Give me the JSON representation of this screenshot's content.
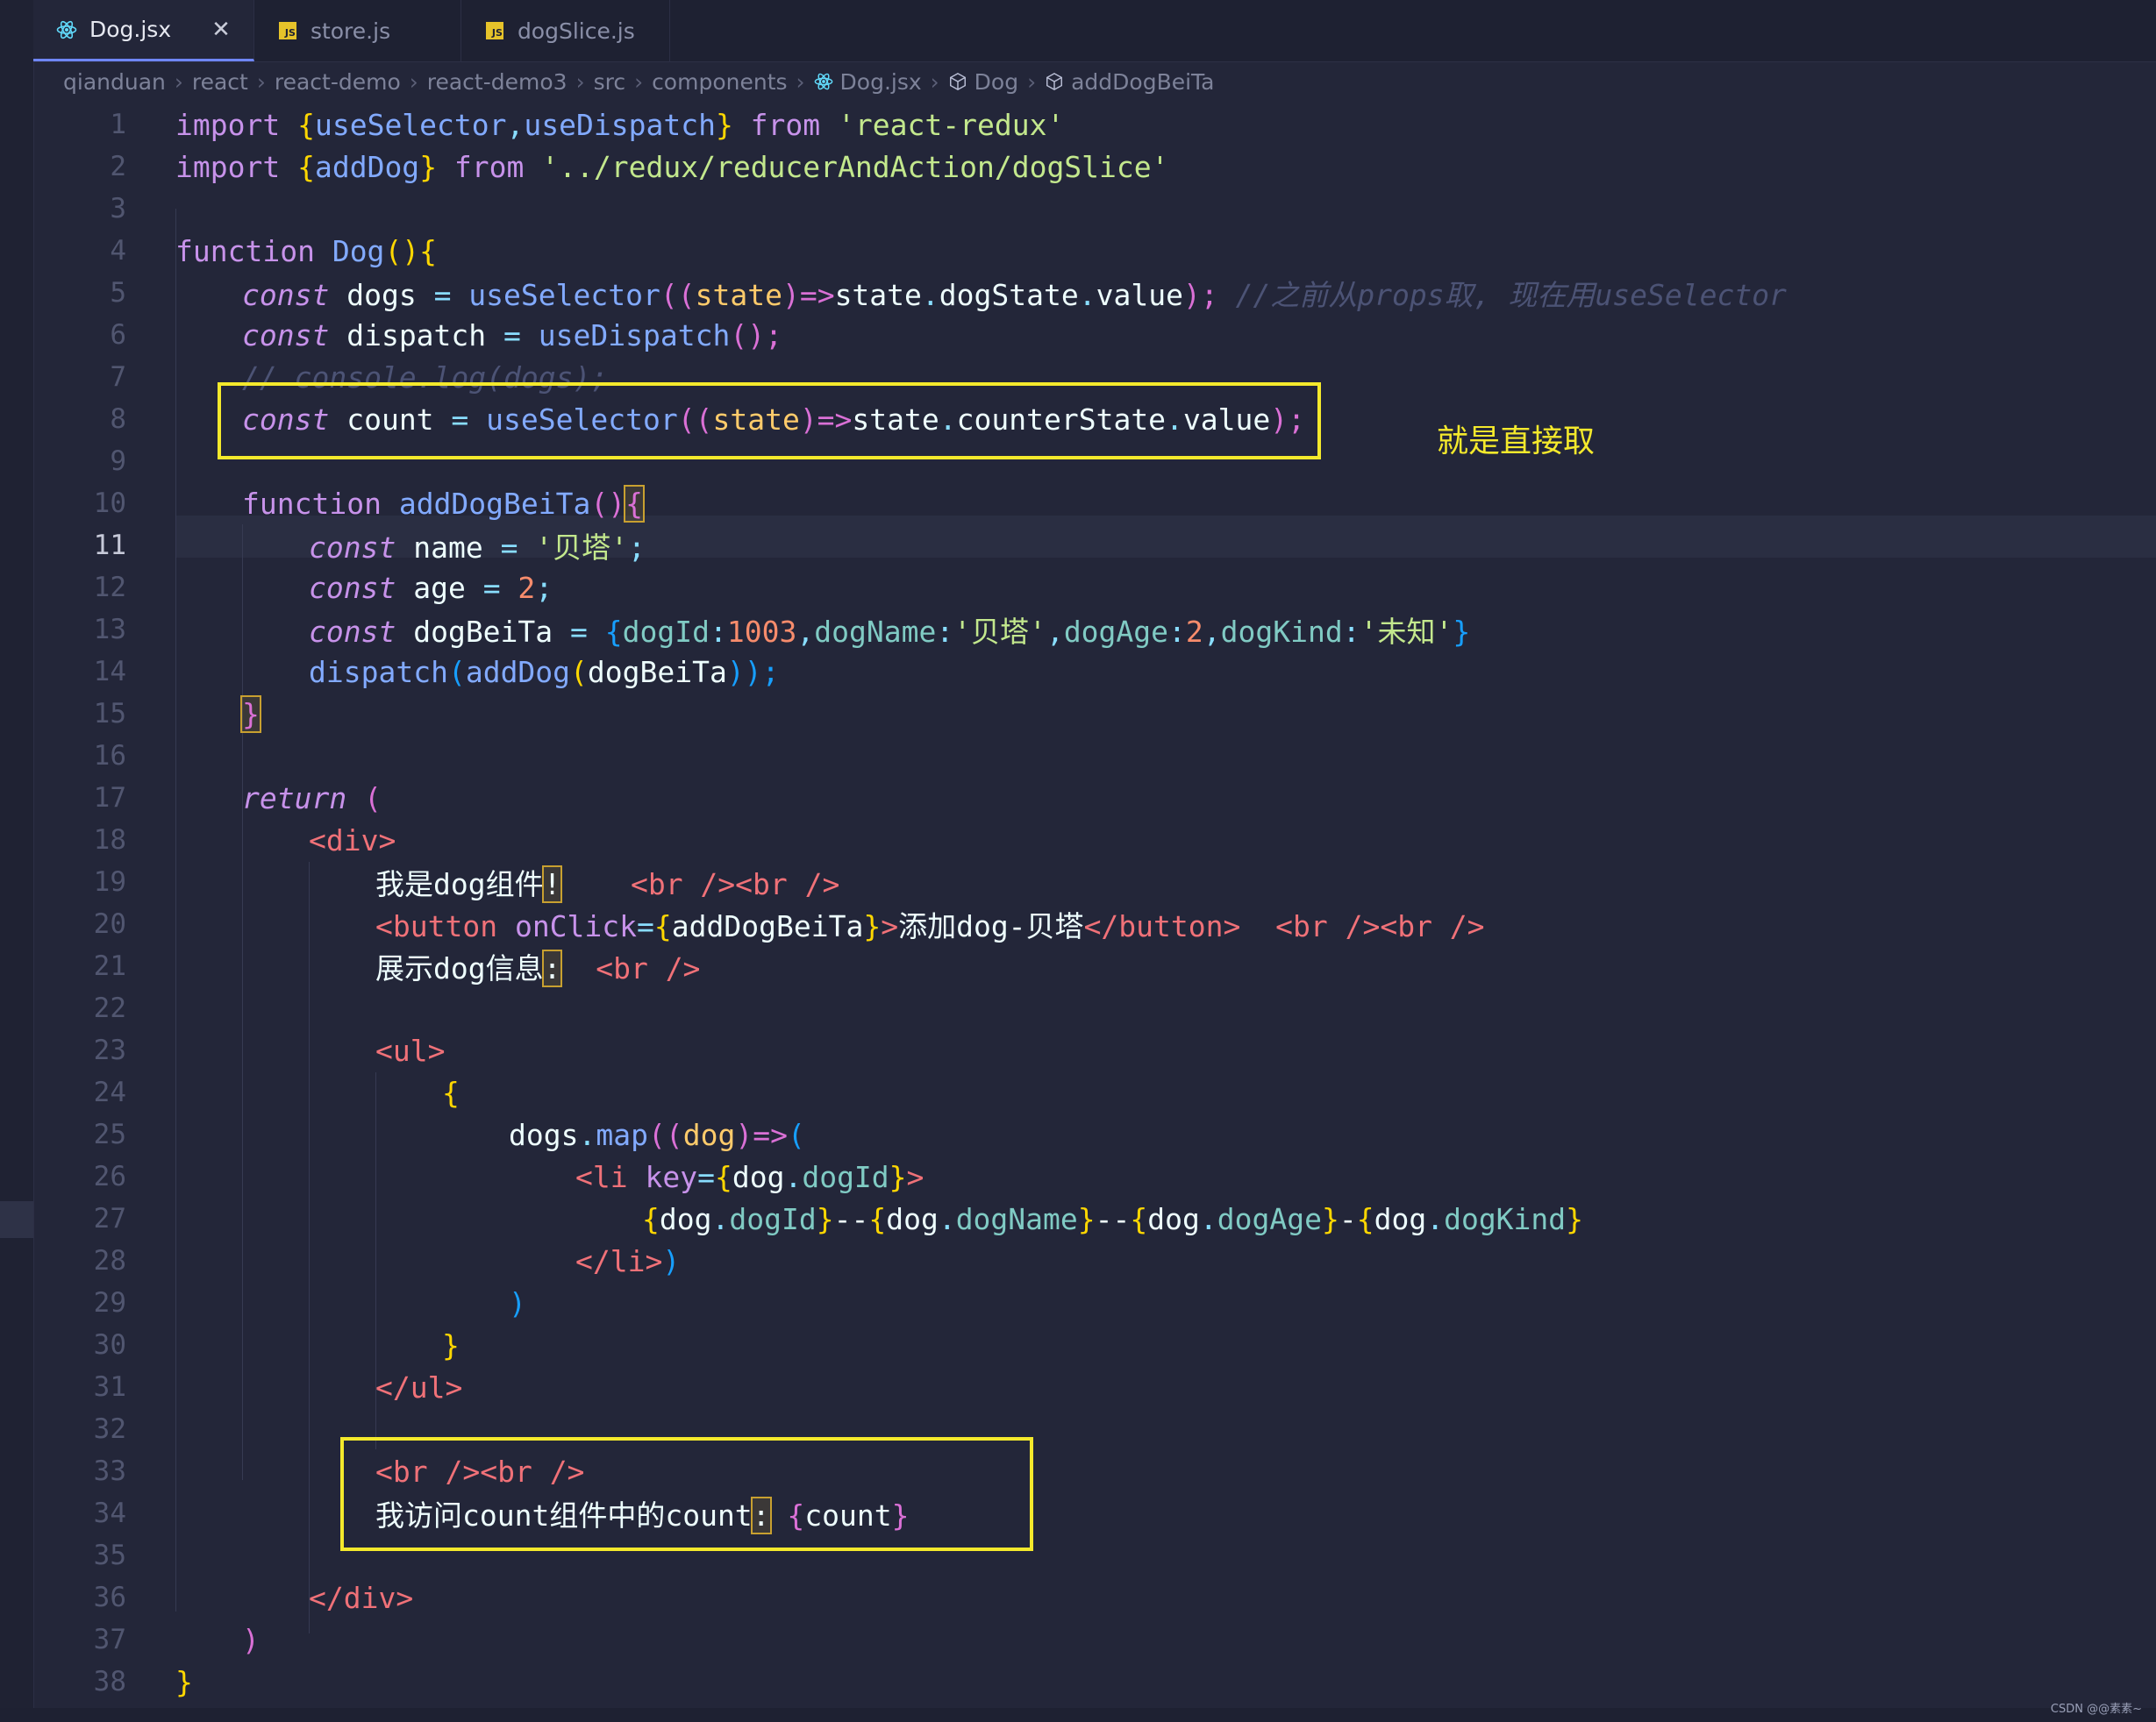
{
  "tabs": [
    {
      "label": "Dog.jsx",
      "icon": "react-icon",
      "active": true
    },
    {
      "label": "store.js",
      "icon": "js-file-icon",
      "active": false
    },
    {
      "label": "dogSlice.js",
      "icon": "js-file-icon",
      "active": false
    }
  ],
  "js_icon_text": "JS",
  "close_glyph": "✕",
  "breadcrumb": [
    "qianduan",
    "react",
    "react-demo",
    "react-demo3",
    "src",
    "components",
    "Dog.jsx",
    "Dog",
    "addDogBeiTa"
  ],
  "active_line": 11,
  "line_numbers": [
    "1",
    "2",
    "3",
    "4",
    "5",
    "6",
    "7",
    "8",
    "9",
    "10",
    "11",
    "12",
    "13",
    "14",
    "15",
    "16",
    "17",
    "18",
    "19",
    "20",
    "21",
    "22",
    "23",
    "24",
    "25",
    "26",
    "27",
    "28",
    "29",
    "30",
    "31",
    "32",
    "33",
    "34",
    "35",
    "36",
    "37",
    "38"
  ],
  "code": {
    "l1": {
      "a": "import",
      "b": " {",
      "c": "useSelector",
      "d": ",",
      "e": "useDispatch",
      "f": "}",
      "g": " from ",
      "h": "'react-redux'"
    },
    "l2": {
      "a": "import",
      "b": " {",
      "c": "addDog",
      "d": "}",
      "e": " from ",
      "f": "'../redux/reducerAndAction/dogSlice'"
    },
    "l4": {
      "a": "function",
      "b": " Dog",
      "c": "(){"
    },
    "l5": {
      "a": "const",
      "b": " dogs ",
      "c": "=",
      "d": " useSelector",
      "e": "((",
      "f": "state",
      "g": ")=>",
      "h": "state",
      "i": ".",
      "j": "dogState",
      "k": ".",
      "l": "value",
      "m": ");",
      "n": " //之前从props取, 现在用useSelector"
    },
    "l6": {
      "a": "const",
      "b": " dispatch ",
      "c": "=",
      "d": " useDispatch",
      "e": "();"
    },
    "l7": {
      "a": "// console.log(dogs);"
    },
    "l8": {
      "a": "const",
      "b": " count ",
      "c": "=",
      "d": " useSelector",
      "e": "((",
      "f": "state",
      "g": ")=>",
      "h": "state",
      "i": ".",
      "j": "counterState",
      "k": ".",
      "l": "value",
      "m": ");"
    },
    "l10": {
      "a": "function",
      "b": " addDogBeiTa",
      "c": "()",
      "d": "{"
    },
    "l11": {
      "a": "const",
      "b": " name ",
      "c": "=",
      "d": " '贝塔'",
      "e": ";"
    },
    "l12": {
      "a": "const",
      "b": " age ",
      "c": "=",
      "d": " 2",
      "e": ";"
    },
    "l13": {
      "a": "const",
      "b": " dogBeiTa ",
      "c": "=",
      "d": " {",
      "e": "dogId",
      "f": ":",
      "g": "1003",
      "h": ",",
      "i": "dogName",
      "j": ":",
      "k": "'贝塔'",
      "l": ",",
      "m": "dogAge",
      "n": ":",
      "o": "2",
      "p": ",",
      "q": "dogKind",
      "r": ":",
      "s": "'未知'",
      "t": "}"
    },
    "l14": {
      "a": "dispatch",
      "b": "(",
      "c": "addDog",
      "d": "(",
      "e": "dogBeiTa",
      "f": "));"
    },
    "l15": {
      "a": "}"
    },
    "l17": {
      "a": "return",
      "b": " ("
    },
    "l18": {
      "a": "<div>"
    },
    "l19": {
      "a": "我是dog组件",
      "b": "!",
      "c": "    <br />",
      "d": "<br />"
    },
    "l20": {
      "a": "<button",
      "b": " onClick",
      "c": "=",
      "d": "{",
      "e": "addDogBeiTa",
      "f": "}",
      "g": ">",
      "h": "添加dog-贝塔",
      "i": "</button>",
      "j": "  <br />",
      "k": "<br />"
    },
    "l21": {
      "a": "展示dog信息",
      "b": ":",
      "c": "  <br />"
    },
    "l23": {
      "a": "<ul>"
    },
    "l24": {
      "a": "{"
    },
    "l25": {
      "a": "dogs",
      "b": ".",
      "c": "map",
      "d": "((",
      "e": "dog",
      "f": ")=>",
      "g": "("
    },
    "l26": {
      "a": "<li",
      "b": " key",
      "c": "=",
      "d": "{",
      "e": "dog",
      "f": ".",
      "g": "dogId",
      "h": "}",
      "i": ">"
    },
    "l27": {
      "a": "{",
      "b": "dog",
      "c": ".",
      "d": "dogId",
      "e": "}",
      "f": "--",
      "g": "{",
      "h": "dog",
      "i": ".",
      "j": "dogName",
      "k": "}",
      "l": "--",
      "m": "{",
      "n": "dog",
      "o": ".",
      "p": "dogAge",
      "q": "}",
      "r": "-",
      "s": "{",
      "t": "dog",
      "u": ".",
      "v": "dogKind",
      "w": "}"
    },
    "l28": {
      "a": "</li>",
      "b": ")"
    },
    "l29": {
      "a": ")"
    },
    "l30": {
      "a": "}"
    },
    "l31": {
      "a": "</ul>"
    },
    "l33": {
      "a": "<br />",
      "b": "<br />"
    },
    "l34": {
      "a": "我访问count组件中的count",
      "b": ":",
      "c": " {",
      "d": "count",
      "e": "}"
    },
    "l36": {
      "a": "</div>"
    },
    "l37": {
      "a": ")"
    },
    "l38": {
      "a": "}"
    }
  },
  "annotation_text": "就是直接取",
  "watermark": "CSDN @@素素~"
}
